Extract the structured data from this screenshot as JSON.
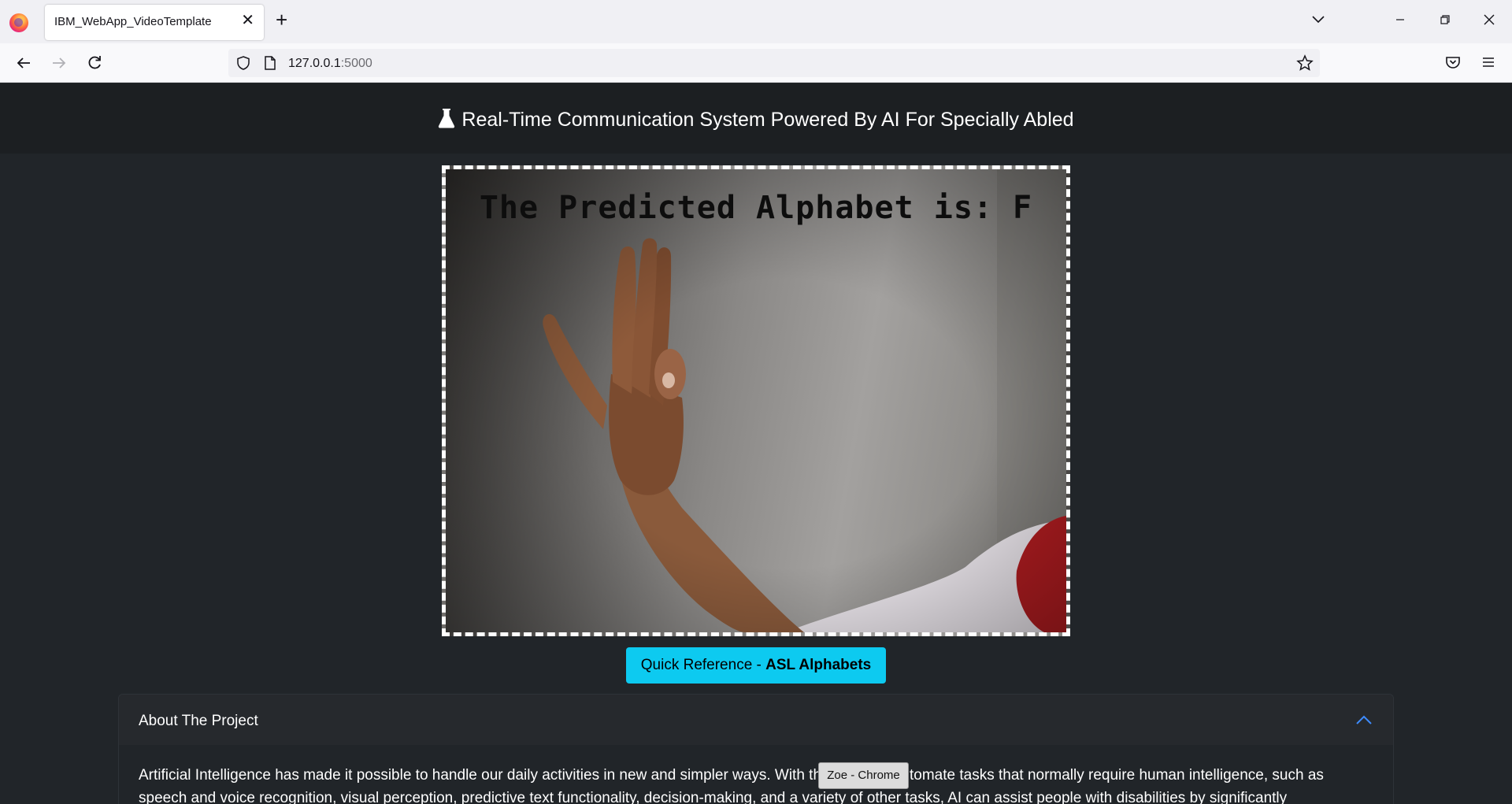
{
  "browser": {
    "tab_title": "IBM_WebApp_VideoTemplate",
    "url_host": "127.0.0.1",
    "url_port": ":5000"
  },
  "page": {
    "title": "Real-Time Communication System Powered By AI For Specially Abled",
    "video": {
      "overlay_text": "The Predicted Alphabet is: F"
    },
    "reference_button": {
      "prefix": "Quick Reference - ",
      "bold": "ASL Alphabets"
    },
    "accordion": {
      "title": "About The Project",
      "body": "Artificial Intelligence has made it possible to handle our daily activities in new and simpler ways. With the ability to automate tasks that normally require human intelligence, such as speech and voice recognition, visual perception, predictive text functionality, decision-making, and a variety of other tasks, AI can assist people with disabilities by significantly"
    }
  },
  "tooltip": {
    "text": "Zoe - Chrome"
  },
  "colors": {
    "page_bg": "#212529",
    "header_bg": "#1c1f22",
    "accent": "#0dcaf0"
  },
  "icons": [
    "firefox-logo-icon",
    "close-icon",
    "plus-icon",
    "chevron-down-icon",
    "minimize-icon",
    "restore-icon",
    "back-icon",
    "forward-icon",
    "reload-icon",
    "shield-icon",
    "page-icon",
    "star-icon",
    "pocket-icon",
    "menu-icon",
    "flask-icon",
    "chevron-up-icon"
  ]
}
